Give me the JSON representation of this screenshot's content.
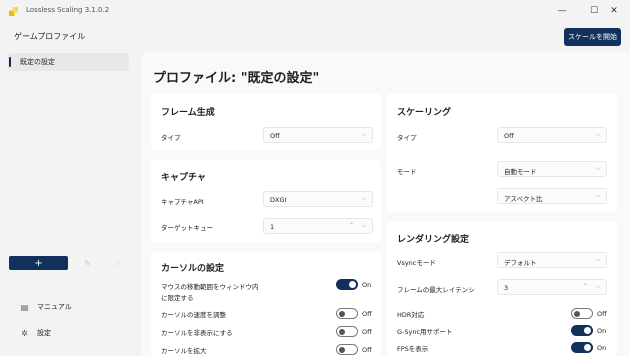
{
  "window": {
    "title": "Lossless Scaling 3.1.0.2",
    "minimize_glyph": "—",
    "maximize_glyph": "☐",
    "close_glyph": "✕"
  },
  "header": {
    "title": "ゲームプロファイル",
    "scale_button": "スケールを開始"
  },
  "sidebar": {
    "profiles": [
      {
        "label": "既定の設定",
        "selected": true
      }
    ],
    "add_label": "+",
    "bottom_items": [
      {
        "label": "マニュアル",
        "icon": "book-icon"
      },
      {
        "label": "設定",
        "icon": "gear-icon"
      }
    ]
  },
  "main": {
    "title": "プロファイル: \"既定の設定\"",
    "frame_generation": {
      "title": "フレーム生成",
      "type_label": "タイプ",
      "type_value": "Off"
    },
    "capture": {
      "title": "キャプチャ",
      "api_label": "キャプチャAPI",
      "api_value": "DXGI",
      "queue_label": "ターゲットキュー",
      "queue_value": "1"
    },
    "cursor": {
      "title": "カーソルの設定",
      "items": [
        {
          "label_line1": "マウスの移動範囲をウィンドウ内",
          "label_line2": "に限定する",
          "state": "On"
        },
        {
          "label_line1": "カーソルの速度を調整",
          "label_line2": "",
          "state": "Off"
        },
        {
          "label_line1": "カーソルを非表示にする",
          "label_line2": "",
          "state": "Off"
        },
        {
          "label_line1": "カーソルを拡大",
          "label_line2": "",
          "state": "Off"
        }
      ]
    },
    "scaling": {
      "title": "スケーリング",
      "type_label": "タイプ",
      "type_value": "Off",
      "mode_label": "モード",
      "mode_value": "自動モード",
      "aspect_value": "アスペクト比"
    },
    "rendering": {
      "title": "レンダリング設定",
      "vsync_label": "Vsyncモード",
      "vsync_value": "デフォルト",
      "latency_label": "フレームの最大レイテンシ",
      "latency_value": "3",
      "toggles": [
        {
          "label": "HDR対応",
          "state": "Off"
        },
        {
          "label": "G-Sync用サポート",
          "state": "On"
        },
        {
          "label": "FPSを表示",
          "state": "On"
        }
      ]
    }
  },
  "colors": {
    "accent": "#12305c",
    "background": "#f3f3f3",
    "card": "#ffffff"
  }
}
